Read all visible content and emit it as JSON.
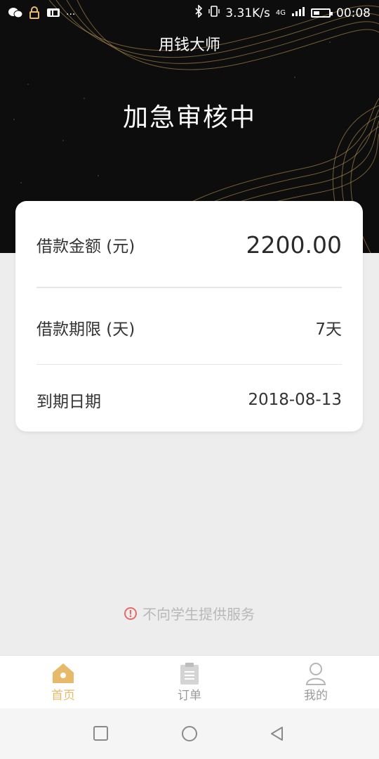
{
  "statusbar": {
    "network_speed": "3.31K/s",
    "network_type": "4G",
    "time": "00:08",
    "more_dots": "···"
  },
  "header": {
    "app_name": "用钱大师",
    "status_title": "加急审核中"
  },
  "loan_card": {
    "amount_label": "借款金额 (元)",
    "amount_value": "2200.00",
    "term_label": "借款期限 (天)",
    "term_value": "7天",
    "due_label": "到期日期",
    "due_value": "2018-08-13"
  },
  "notice": {
    "icon": "warning-circle-icon",
    "text": "不向学生提供服务"
  },
  "tabbar": {
    "items": [
      {
        "label": "首页",
        "icon": "home-icon",
        "active": true
      },
      {
        "label": "订单",
        "icon": "clipboard-icon",
        "active": false
      },
      {
        "label": "我的",
        "icon": "user-icon",
        "active": false
      }
    ]
  },
  "colors": {
    "accent": "#e7b96a",
    "tab_inactive": "#9a9a9a",
    "hero_bg": "#0d0d0d",
    "page_bg": "#ededed"
  }
}
